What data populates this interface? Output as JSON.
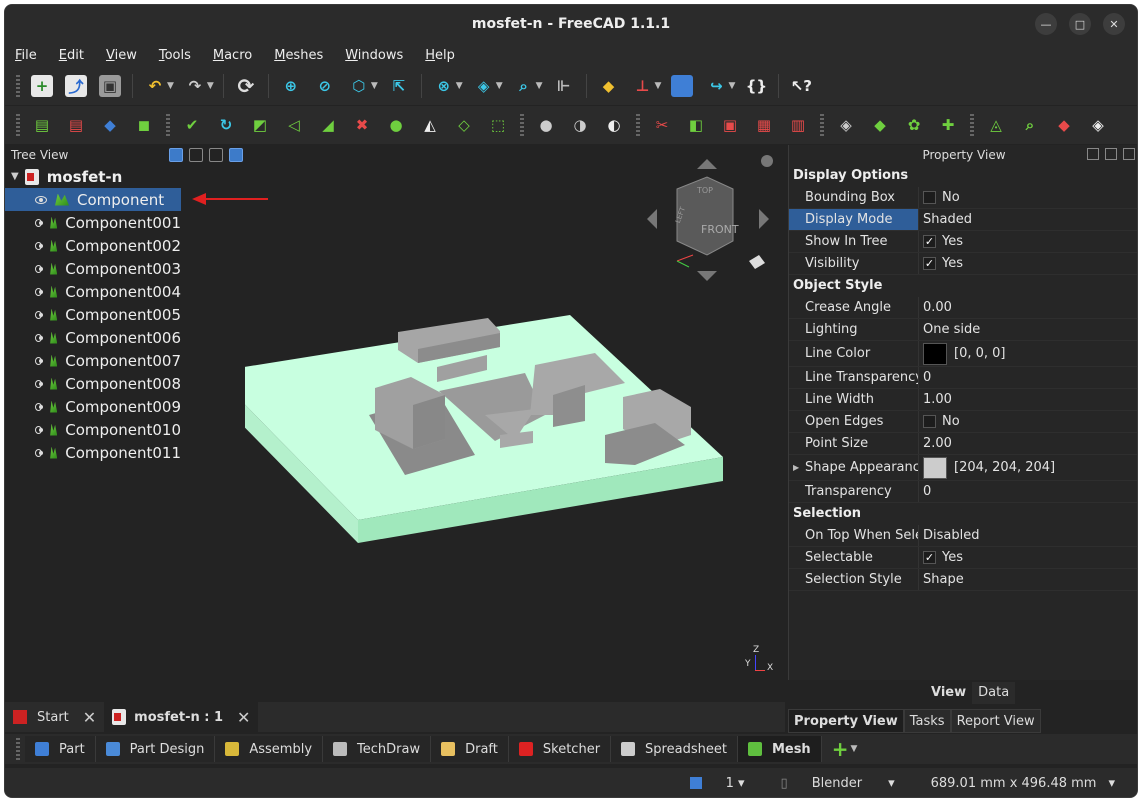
{
  "window": {
    "title": "mosfet-n - FreeCAD 1.1.1"
  },
  "menu": [
    "File",
    "Edit",
    "View",
    "Tools",
    "Macro",
    "Meshes",
    "Windows",
    "Help"
  ],
  "tree": {
    "header": "Tree View",
    "root": "mosfet-n",
    "items": [
      "Component",
      "Component001",
      "Component002",
      "Component003",
      "Component004",
      "Component005",
      "Component006",
      "Component007",
      "Component008",
      "Component009",
      "Component010",
      "Component011"
    ],
    "selected_index": 0
  },
  "navcube": {
    "top": "TOP",
    "front": "FRONT",
    "left": "LEFT"
  },
  "axes": {
    "z": "Z",
    "y": "Y",
    "x": "X"
  },
  "property_view": {
    "header": "Property View",
    "groups": [
      {
        "name": "Display Options",
        "rows": [
          {
            "key": "Bounding Box",
            "value": "No",
            "check": "",
            "checkbox": true
          },
          {
            "key": "Display Mode",
            "value": "Shaded",
            "selected": true
          },
          {
            "key": "Show In Tree",
            "value": "Yes",
            "check": "✓",
            "checkbox": true
          },
          {
            "key": "Visibility",
            "value": "Yes",
            "check": "✓",
            "checkbox": true
          }
        ]
      },
      {
        "name": "Object Style",
        "rows": [
          {
            "key": "Crease Angle",
            "value": "0.00"
          },
          {
            "key": "Lighting",
            "value": "One side"
          },
          {
            "key": "Line Color",
            "value": "[0, 0, 0]",
            "swatch": "#000000"
          },
          {
            "key": "Line Transparency",
            "value": "0"
          },
          {
            "key": "Line Width",
            "value": "1.00"
          },
          {
            "key": "Open Edges",
            "value": "No",
            "check": "",
            "checkbox": true
          },
          {
            "key": "Point Size",
            "value": "2.00"
          },
          {
            "key": "Shape Appearance",
            "value": "[204, 204, 204]",
            "swatch": "#cccccc",
            "expandable": true
          },
          {
            "key": "Transparency",
            "value": "0"
          }
        ]
      },
      {
        "name": "Selection",
        "rows": [
          {
            "key": "On Top When Sele...",
            "value": "Disabled"
          },
          {
            "key": "Selectable",
            "value": "Yes",
            "check": "✓",
            "checkbox": true
          },
          {
            "key": "Selection Style",
            "value": "Shape"
          }
        ]
      }
    ],
    "tabs": [
      "View",
      "Data"
    ],
    "active_tab": "View"
  },
  "combo_tabs": [
    "Property View",
    "Tasks",
    "Report View"
  ],
  "doc_tabs": [
    {
      "label": "Start"
    },
    {
      "label": "mosfet-n : 1",
      "active": true
    }
  ],
  "workbenches": [
    {
      "label": "Part",
      "color": "#3f7fd6"
    },
    {
      "label": "Part Design",
      "color": "#4a8ad8"
    },
    {
      "label": "Assembly",
      "color": "#d8b83a"
    },
    {
      "label": "TechDraw",
      "color": "#bbbbbb"
    },
    {
      "label": "Draft",
      "color": "#e8c060"
    },
    {
      "label": "Sketcher",
      "color": "#d22"
    },
    {
      "label": "Spreadsheet",
      "color": "#cccccc"
    },
    {
      "label": "Mesh",
      "color": "#5fbf3f",
      "active": true
    }
  ],
  "status": {
    "pages": "1",
    "nav_style": "Blender",
    "dimensions": "689.01 mm x 496.48 mm"
  },
  "colors": {
    "accent": "#2f5e99",
    "arrow": "#e02020",
    "base_plate": "#c8ffe0",
    "component": "#a8a8a8"
  }
}
